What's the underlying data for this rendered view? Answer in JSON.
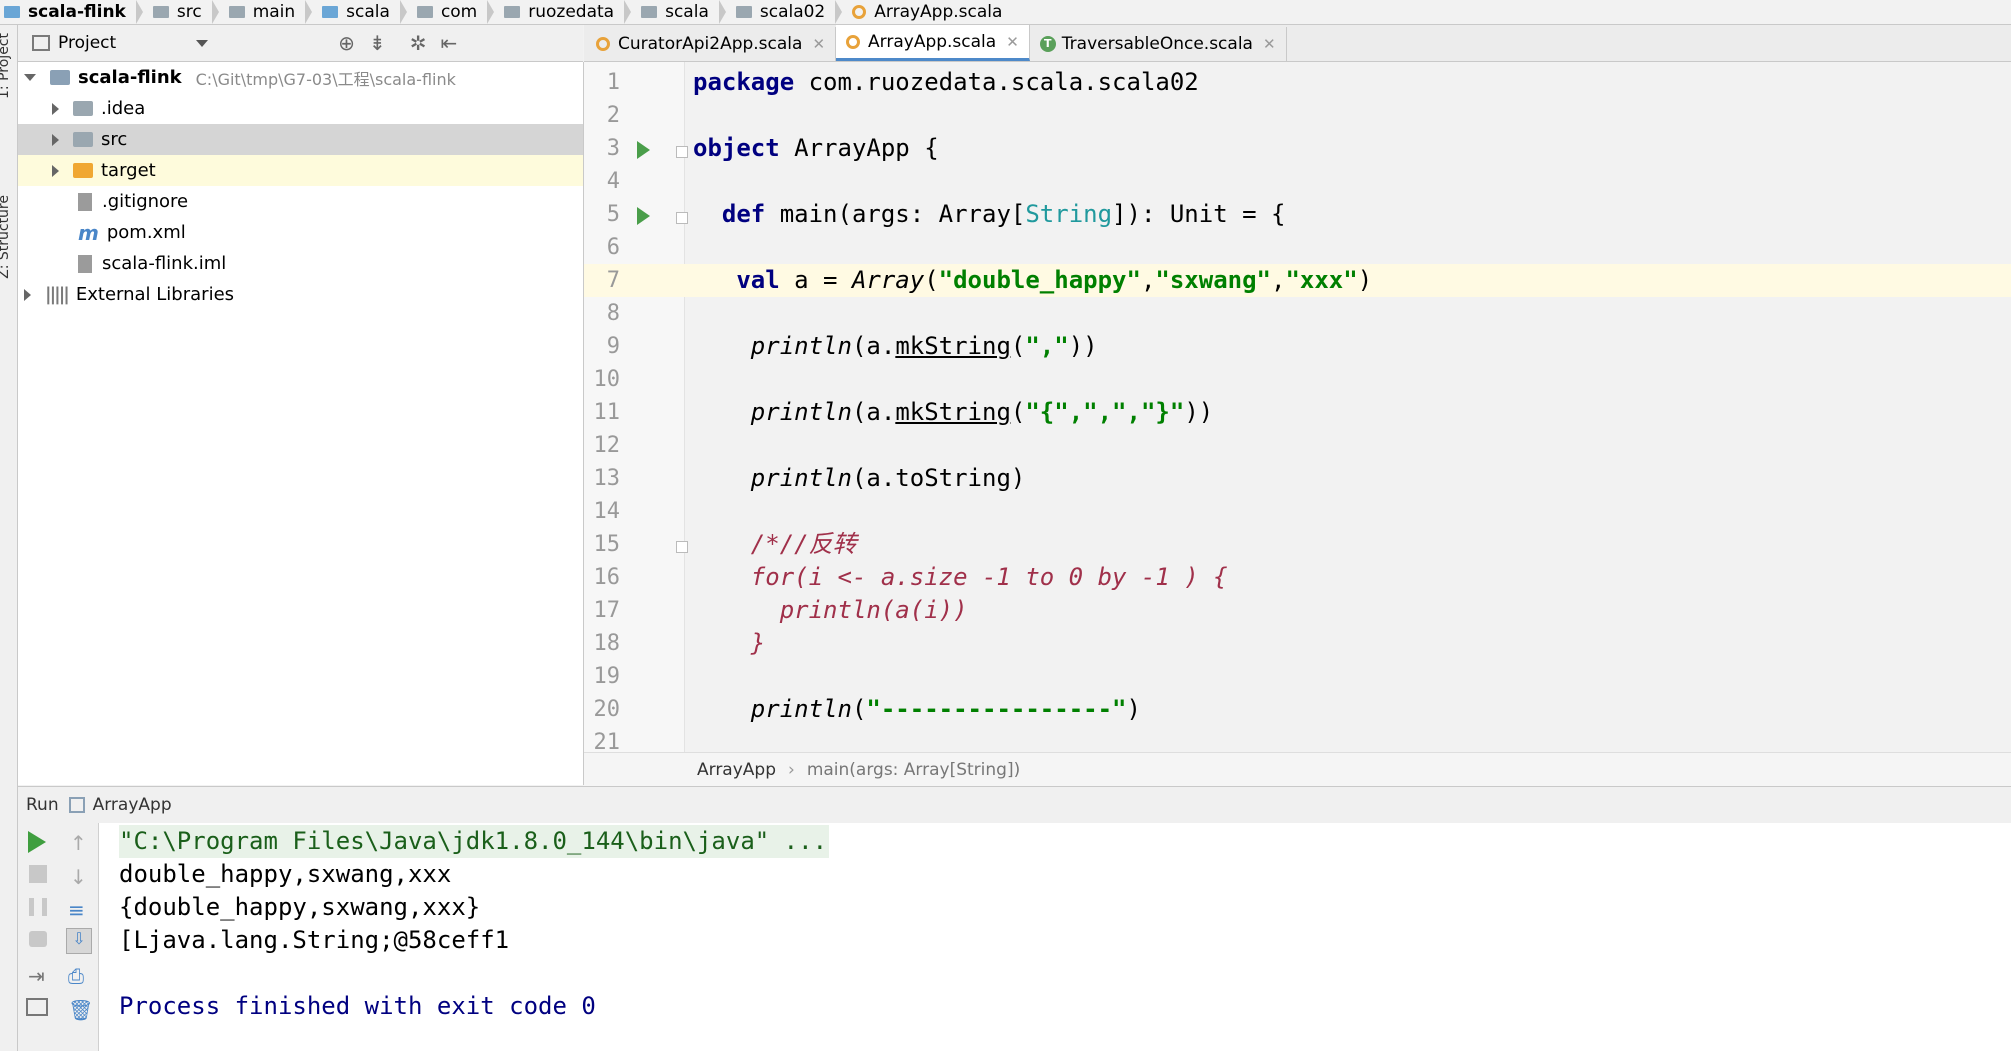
{
  "breadcrumb": [
    {
      "label": "scala-flink",
      "icon": "module-folder-icon",
      "bold": true
    },
    {
      "label": "src",
      "icon": "folder-icon"
    },
    {
      "label": "main",
      "icon": "folder-icon"
    },
    {
      "label": "scala",
      "icon": "source-folder-icon"
    },
    {
      "label": "com",
      "icon": "package-icon"
    },
    {
      "label": "ruozedata",
      "icon": "package-icon"
    },
    {
      "label": "scala",
      "icon": "package-icon"
    },
    {
      "label": "scala02",
      "icon": "package-icon"
    },
    {
      "label": "ArrayApp.scala",
      "icon": "scala-object-icon"
    }
  ],
  "side_strip": {
    "project_label": "1: Project",
    "structure_label": "Z: Structure"
  },
  "project_panel": {
    "title": "Project",
    "tree": [
      {
        "label": "scala-flink",
        "path": "C:\\Git\\tmp\\G7-03\\工程\\scala-flink",
        "bold": true,
        "expanded": true
      },
      {
        "label": ".idea"
      },
      {
        "label": "src"
      },
      {
        "label": "target"
      },
      {
        "label": ".gitignore"
      },
      {
        "label": "pom.xml"
      },
      {
        "label": "scala-flink.iml"
      },
      {
        "label": "External Libraries"
      }
    ]
  },
  "tabs": [
    {
      "label": "CuratorApi2App.scala",
      "active": false
    },
    {
      "label": "ArrayApp.scala",
      "active": true
    },
    {
      "label": "TraversableOnce.scala",
      "active": false
    }
  ],
  "editor": {
    "line_numbers": [
      "1",
      "2",
      "3",
      "4",
      "5",
      "6",
      "7",
      "8",
      "9",
      "10",
      "11",
      "12",
      "13",
      "14",
      "15",
      "16",
      "17",
      "18",
      "19",
      "20",
      "21"
    ],
    "lines": {
      "l1a": "package",
      "l1b": " com.ruozedata.scala.scala02",
      "l3a": "object",
      "l3b": " ArrayApp {",
      "l5a": "  def",
      "l5b": " main(args: Array[",
      "l5c": "String",
      "l5d": "]): Unit = {",
      "l7a": "   val",
      "l7b": " a = ",
      "l7c": "Array",
      "l7d": "(",
      "l7e": "\"double_happy\"",
      "l7f": ",",
      "l7g": "\"sxwang\"",
      "l7h": ",",
      "l7i": "\"xxx\"",
      "l7j": ")",
      "l9a": "    println",
      "l9b": "(a.",
      "l9c": "mkString",
      "l9d": "(",
      "l9e": "\",\"",
      "l9f": "))",
      "l11a": "    println",
      "l11b": "(a.",
      "l11c": "mkString",
      "l11d": "(",
      "l11e": "\"{\",\",\",\"}\"",
      "l11f": "))",
      "l13a": "    println",
      "l13b": "(a.toString)",
      "l15": "    /*//反转",
      "l16": "    for(i <- a.size -1 to 0 by -1 ) {",
      "l17": "      println(a(i))",
      "l18": "    }",
      "l20a": "    println",
      "l20b": "(",
      "l20c": "\"----------------\"",
      "l20d": ")"
    },
    "crumb": {
      "object": "ArrayApp",
      "method": "main(args: Array[String])"
    }
  },
  "run": {
    "label": "Run",
    "config": "ArrayApp",
    "output": [
      "\"C:\\Program Files\\Java\\jdk1.8.0_144\\bin\\java\" ...",
      "double_happy,sxwang,xxx",
      "{double_happy,sxwang,xxx}",
      "[Ljava.lang.String;@58ceff1",
      "",
      "Process finished with exit code 0"
    ]
  }
}
